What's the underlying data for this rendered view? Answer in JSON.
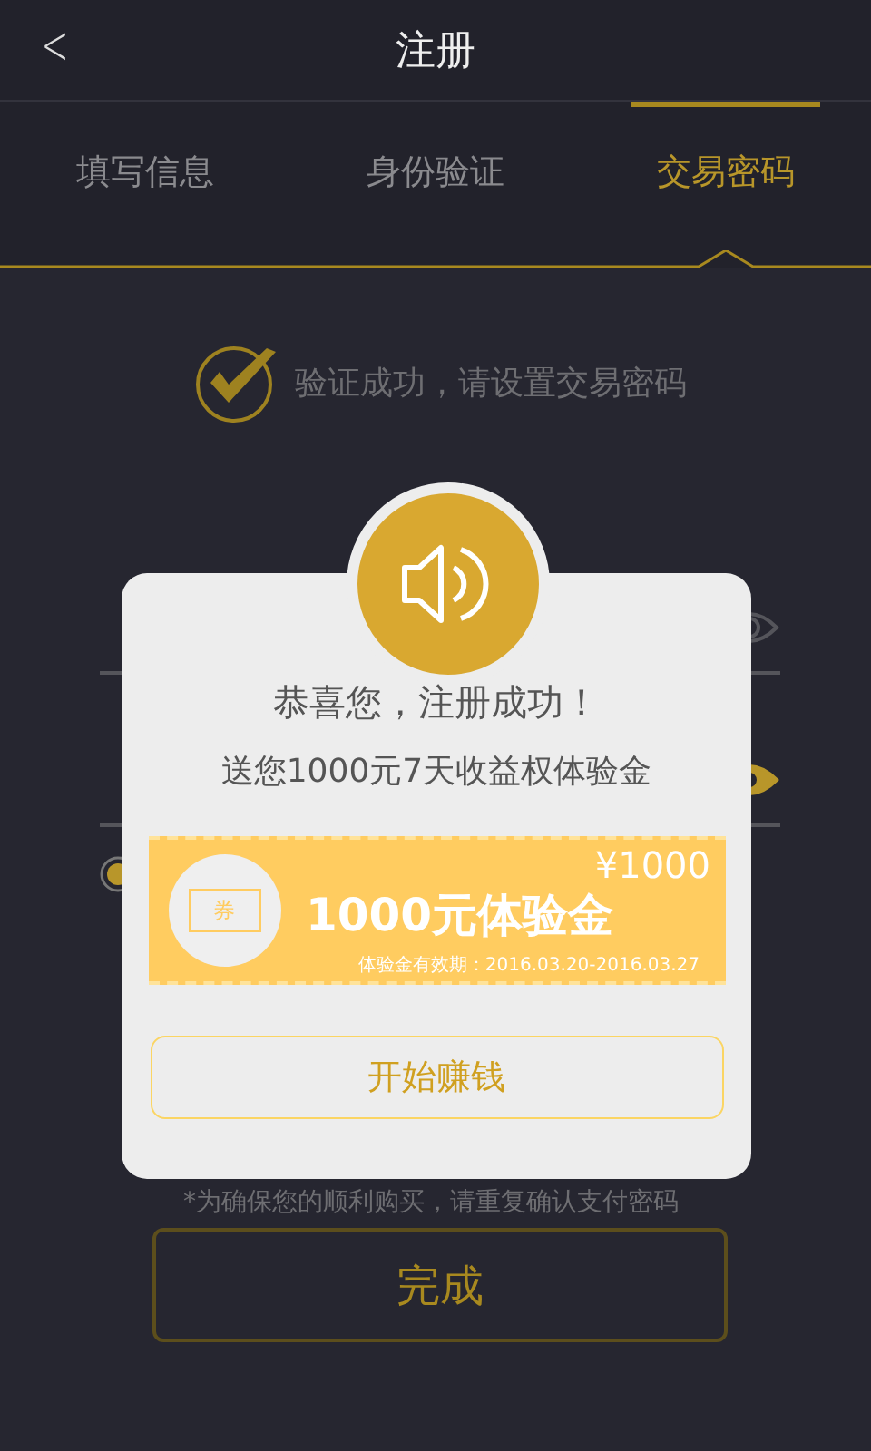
{
  "header": {
    "back": "<",
    "title": "注册"
  },
  "tabs": [
    {
      "label": "填写信息",
      "selected": false
    },
    {
      "label": "身份验证",
      "selected": false
    },
    {
      "label": "交易密码",
      "selected": true
    }
  ],
  "status": {
    "message": "验证成功，请设置交易密码"
  },
  "fields": [
    {
      "kind": "password",
      "visible": false
    },
    {
      "kind": "password",
      "visible": true
    }
  ],
  "note": "*为确保您的顺利购买，请重复确认支付密码",
  "done_button": "完成",
  "dialog": {
    "title": "恭喜您，注册成功！",
    "subtitle": "送您1000元7天收益权体验金",
    "coupon": {
      "stamp": "券",
      "amount": "¥1000",
      "name": "1000元体验金",
      "validity": "体验金有效期：2016.03.20-2016.03.27"
    },
    "button": "开始赚钱"
  }
}
